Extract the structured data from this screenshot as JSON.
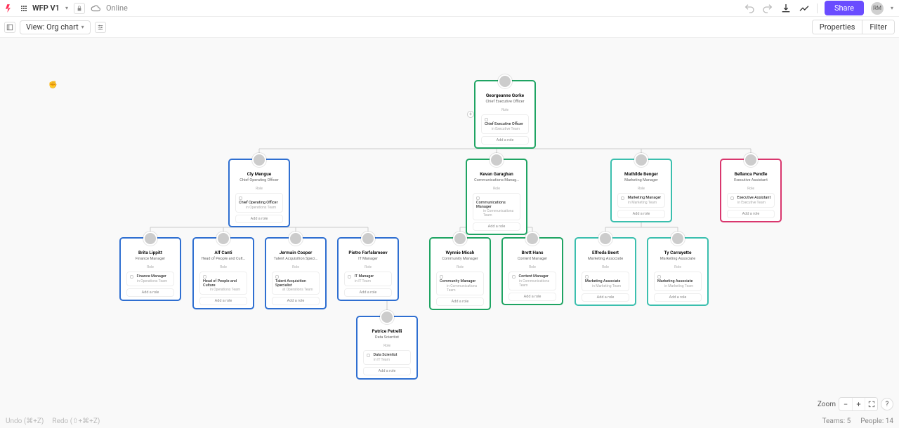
{
  "topbar": {
    "doc_title": "WFP V1",
    "online_label": "Online",
    "share_label": "Share",
    "user_initials": "RM"
  },
  "secbar": {
    "view_label": "View: Org chart",
    "properties_label": "Properties",
    "filter_label": "Filter"
  },
  "status": {
    "undo": "Undo (⌘+Z)",
    "redo": "Redo (⇧+⌘+Z)",
    "teams_label": "Teams:",
    "teams_count": "5",
    "people_label": "People:",
    "people_count": "14"
  },
  "zoom": {
    "label": "Zoom"
  },
  "cards": {
    "role_label": "Role",
    "add_role": "Add a role",
    "ceo": {
      "name": "Georgeanne Gorke",
      "title": "Chief Executive Officer",
      "role_name": "Chief Executive Officer",
      "role_team": "in Executive Team"
    },
    "coo": {
      "name": "Cly Mengue",
      "title": "Chief Operating Officer",
      "role_name": "Chief Operating Officer",
      "role_team": "in Operations Team"
    },
    "comm": {
      "name": "Kevan Garaghan",
      "title": "Communications Manag…",
      "role_name": "Communications Manager",
      "role_team": "in Communications Team"
    },
    "mkt": {
      "name": "Mathilde Benger",
      "title": "Marketing Manager",
      "role_name": "Marketing Manager",
      "role_team": "in Marketing Team"
    },
    "exec": {
      "name": "Bellanca Pendle",
      "title": "Executive Assistant",
      "role_name": "Executive Assistant",
      "role_team": "in Executive Team"
    },
    "fin": {
      "name": "Brita Lippitt",
      "title": "Finance Manager",
      "role_name": "Finance Manager",
      "role_team": "in Operations Team"
    },
    "hr": {
      "name": "Alf Canti",
      "title": "Head of People and Cult…",
      "role_name": "Head of People and Culture",
      "role_team": "in Operations Team"
    },
    "ta": {
      "name": "Jermain Cooper",
      "title": "Talent Acquisition Speci…",
      "role_name": "Talent Acquisition Specialist",
      "role_team": "at Operations Team"
    },
    "it": {
      "name": "Pietro Farfalameev",
      "title": "IT Manager",
      "role_name": "IT Manager",
      "role_team": "in IT Team"
    },
    "community": {
      "name": "Wynnie Micah",
      "title": "Community Manager",
      "role_name": "Community Manager",
      "role_team": "in Communications Team"
    },
    "content": {
      "name": "Brett Hans",
      "title": "Content Manager",
      "role_name": "Content Manager",
      "role_team": "in Communications Team"
    },
    "mk1": {
      "name": "Elfreda Beert",
      "title": "Marketing Associate",
      "role_name": "Marketing Associate",
      "role_team": "in Marketing Team"
    },
    "mk2": {
      "name": "Ty Carrayette",
      "title": "Marketing Associate",
      "role_name": "Marketing Associate",
      "role_team": "in Marketing Team"
    },
    "ds": {
      "name": "Patrice Petrelli",
      "title": "Data Scientist",
      "role_name": "Data Scientist",
      "role_team": "in IT Team"
    }
  }
}
